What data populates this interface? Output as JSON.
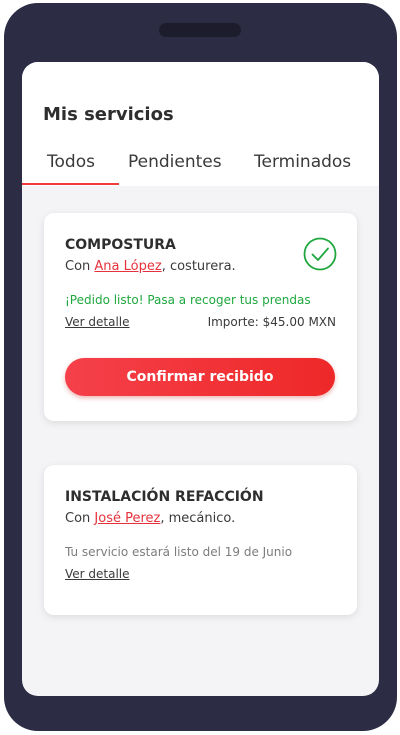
{
  "header": {
    "title": "Mis servicios"
  },
  "tabs": [
    {
      "label": "Todos",
      "active": true
    },
    {
      "label": "Pendientes",
      "active": false
    },
    {
      "label": "Terminados",
      "active": false
    }
  ],
  "services": [
    {
      "title": "COMPOSTURA",
      "with_prefix": "Con ",
      "provider": "Ana López",
      "role": ", costurera.",
      "status": "¡Pedido listo! Pasa a recoger tus prendas",
      "detail_label": "Ver detalle",
      "amount": "Importe: $45.00 MXN",
      "action_label": "Confirmar recibido",
      "status_icon": "check-circle-icon"
    },
    {
      "title": "INSTALACIÓN REFACCIÓN",
      "with_prefix": "Con ",
      "provider": "José Perez",
      "role": ", mecánico.",
      "status": "Tu servicio estará listo del 19 de Junio",
      "detail_label": "Ver detalle"
    }
  ],
  "colors": {
    "accent": "#ef3b3b",
    "success": "#1fa83f",
    "frame": "#2c2d45"
  }
}
